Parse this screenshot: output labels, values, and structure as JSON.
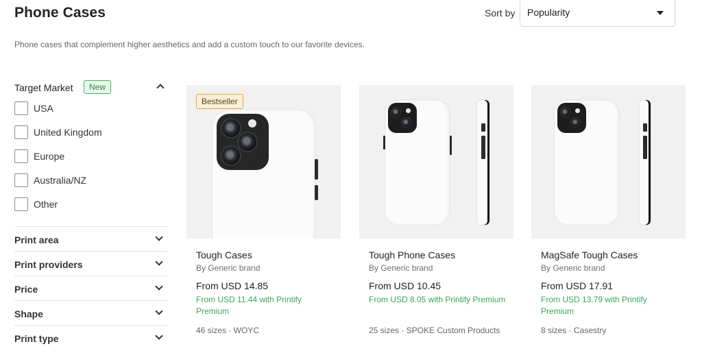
{
  "header": {
    "title": "Phone Cases",
    "sort_label": "Sort by",
    "sort_value": "Popularity",
    "description": "Phone cases that complement higher aesthetics and add a custom touch to our favorite devices."
  },
  "sidebar": {
    "target_market": {
      "label": "Target Market",
      "badge": "New",
      "options": [
        "USA",
        "United Kingdom",
        "Europe",
        "Australia/NZ",
        "Other"
      ]
    },
    "filters": [
      "Print area",
      "Print providers",
      "Price",
      "Shape",
      "Print type"
    ]
  },
  "products": [
    {
      "name": "Tough Cases",
      "brand": "By Generic brand",
      "price": "From USD 14.85",
      "premium": "From USD 11.44 with Printify Premium",
      "meta": "46 sizes · WOYC",
      "badge": "Bestseller"
    },
    {
      "name": "Tough Phone Cases",
      "brand": "By Generic brand",
      "price": "From USD 10.45",
      "premium": "From USD 8.05 with Printify Premium",
      "meta": "25 sizes · SPOKE Custom Products"
    },
    {
      "name": "MagSafe Tough Cases",
      "brand": "By Generic brand",
      "price": "From USD 17.91",
      "premium": "From USD 13.79 with Printify Premium",
      "meta": "8 sizes · Casestry"
    }
  ]
}
